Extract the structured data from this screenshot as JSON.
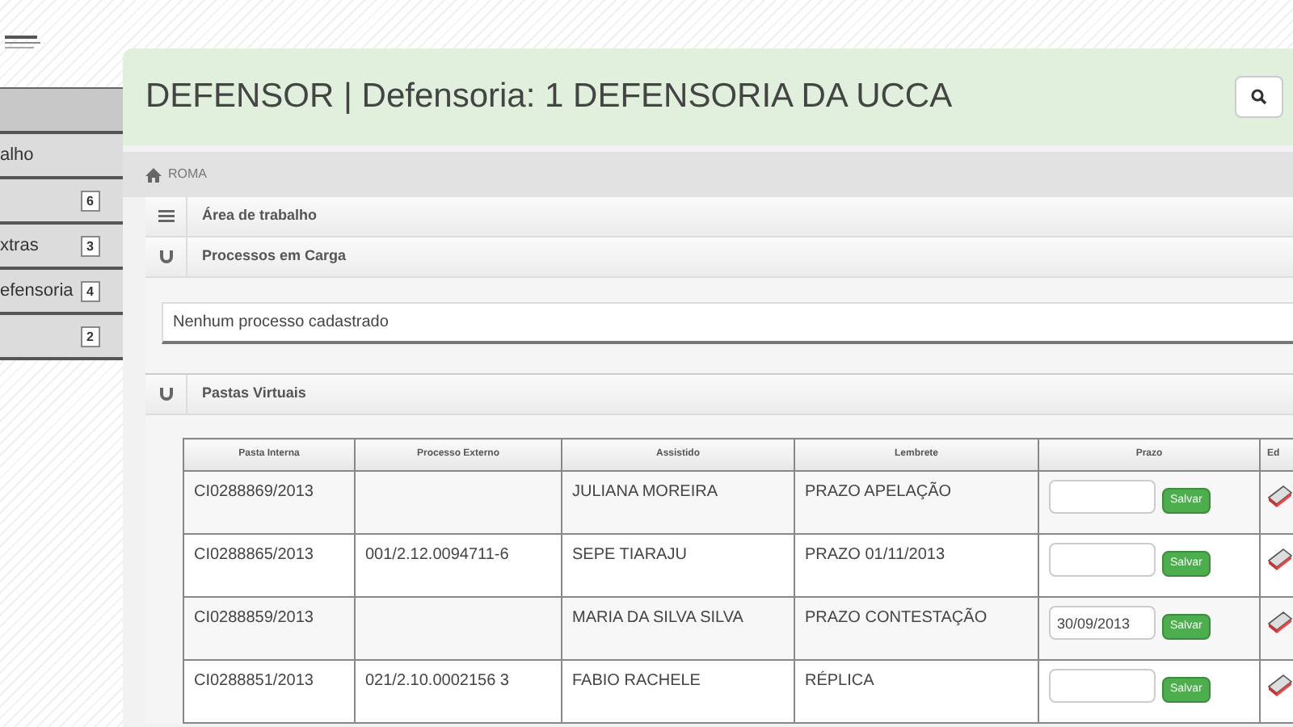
{
  "header": {
    "title": "DEFENSOR | Defensoria: 1 DEFENSORIA DA UCCA"
  },
  "sidebar": {
    "items": [
      {
        "selected": true
      },
      {
        "label": "alho",
        "selected": false
      },
      {
        "badge": "6",
        "selected": false
      },
      {
        "label": "xtras",
        "badge": "3",
        "selected": false
      },
      {
        "label": "efensoria",
        "badge": "4",
        "selected": false
      },
      {
        "badge": "2",
        "selected": false
      }
    ]
  },
  "breadcrumb": "ROMA",
  "sections": [
    {
      "kind": "menu",
      "title": "Área de trabalho"
    },
    {
      "kind": "magnet",
      "title": "Processos em Carga",
      "empty_message": "Nenhum processo cadastrado"
    },
    {
      "kind": "magnet",
      "title": "Pastas Virtuais"
    }
  ],
  "table": {
    "columns": [
      "Pasta Interna",
      "Processo Externo",
      "Assistido",
      "Lembrete",
      "Prazo",
      "Ed"
    ],
    "rows": [
      {
        "pasta": "CI0288869/2013",
        "assistido": "JULIANA MOREIRA",
        "lembrete": "PRAZO APELAÇÃO",
        "save_label": "Salvar"
      },
      {
        "pasta": "CI0288865/2013",
        "processo": "001/2.12.0094711-6",
        "assistido": "SEPE TIARAJU",
        "lembrete": "PRAZO 01/11/2013",
        "save_label": "Salvar"
      },
      {
        "pasta": "CI0288859/2013",
        "assistido": "MARIA DA SILVA SILVA",
        "lembrete": "PRAZO CONTESTAÇÃO",
        "prazo": "30/09/2013",
        "save_label": "Salvar"
      },
      {
        "pasta": "CI0288851/2013",
        "processo": "021/2.10.0002156 3",
        "assistido": "FABIO RACHELE",
        "lembrete": "RÉPLICA",
        "save_label": "Salvar"
      }
    ]
  }
}
